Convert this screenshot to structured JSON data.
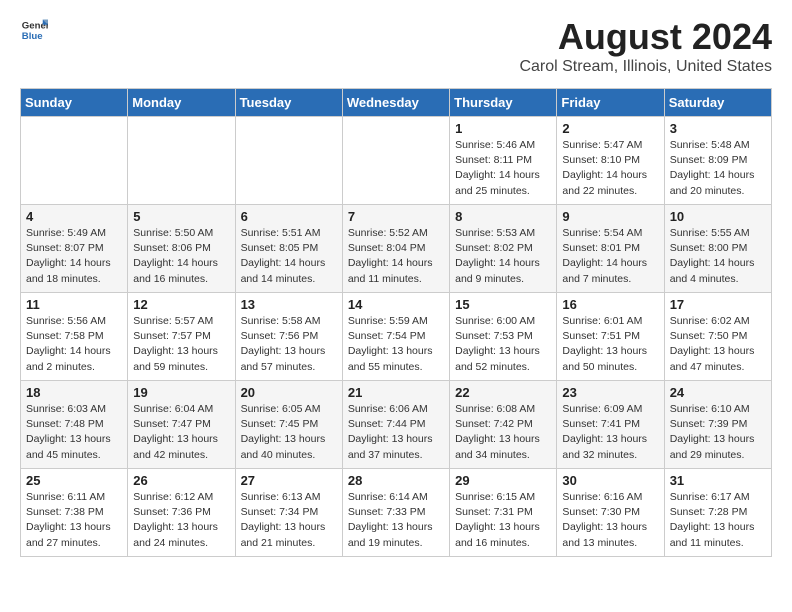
{
  "header": {
    "logo_general": "General",
    "logo_blue": "Blue",
    "month_title": "August 2024",
    "location": "Carol Stream, Illinois, United States"
  },
  "columns": [
    "Sunday",
    "Monday",
    "Tuesday",
    "Wednesday",
    "Thursday",
    "Friday",
    "Saturday"
  ],
  "weeks": [
    [
      {
        "day": "",
        "content": ""
      },
      {
        "day": "",
        "content": ""
      },
      {
        "day": "",
        "content": ""
      },
      {
        "day": "",
        "content": ""
      },
      {
        "day": "1",
        "content": "Sunrise: 5:46 AM\nSunset: 8:11 PM\nDaylight: 14 hours\nand 25 minutes."
      },
      {
        "day": "2",
        "content": "Sunrise: 5:47 AM\nSunset: 8:10 PM\nDaylight: 14 hours\nand 22 minutes."
      },
      {
        "day": "3",
        "content": "Sunrise: 5:48 AM\nSunset: 8:09 PM\nDaylight: 14 hours\nand 20 minutes."
      }
    ],
    [
      {
        "day": "4",
        "content": "Sunrise: 5:49 AM\nSunset: 8:07 PM\nDaylight: 14 hours\nand 18 minutes."
      },
      {
        "day": "5",
        "content": "Sunrise: 5:50 AM\nSunset: 8:06 PM\nDaylight: 14 hours\nand 16 minutes."
      },
      {
        "day": "6",
        "content": "Sunrise: 5:51 AM\nSunset: 8:05 PM\nDaylight: 14 hours\nand 14 minutes."
      },
      {
        "day": "7",
        "content": "Sunrise: 5:52 AM\nSunset: 8:04 PM\nDaylight: 14 hours\nand 11 minutes."
      },
      {
        "day": "8",
        "content": "Sunrise: 5:53 AM\nSunset: 8:02 PM\nDaylight: 14 hours\nand 9 minutes."
      },
      {
        "day": "9",
        "content": "Sunrise: 5:54 AM\nSunset: 8:01 PM\nDaylight: 14 hours\nand 7 minutes."
      },
      {
        "day": "10",
        "content": "Sunrise: 5:55 AM\nSunset: 8:00 PM\nDaylight: 14 hours\nand 4 minutes."
      }
    ],
    [
      {
        "day": "11",
        "content": "Sunrise: 5:56 AM\nSunset: 7:58 PM\nDaylight: 14 hours\nand 2 minutes."
      },
      {
        "day": "12",
        "content": "Sunrise: 5:57 AM\nSunset: 7:57 PM\nDaylight: 13 hours\nand 59 minutes."
      },
      {
        "day": "13",
        "content": "Sunrise: 5:58 AM\nSunset: 7:56 PM\nDaylight: 13 hours\nand 57 minutes."
      },
      {
        "day": "14",
        "content": "Sunrise: 5:59 AM\nSunset: 7:54 PM\nDaylight: 13 hours\nand 55 minutes."
      },
      {
        "day": "15",
        "content": "Sunrise: 6:00 AM\nSunset: 7:53 PM\nDaylight: 13 hours\nand 52 minutes."
      },
      {
        "day": "16",
        "content": "Sunrise: 6:01 AM\nSunset: 7:51 PM\nDaylight: 13 hours\nand 50 minutes."
      },
      {
        "day": "17",
        "content": "Sunrise: 6:02 AM\nSunset: 7:50 PM\nDaylight: 13 hours\nand 47 minutes."
      }
    ],
    [
      {
        "day": "18",
        "content": "Sunrise: 6:03 AM\nSunset: 7:48 PM\nDaylight: 13 hours\nand 45 minutes."
      },
      {
        "day": "19",
        "content": "Sunrise: 6:04 AM\nSunset: 7:47 PM\nDaylight: 13 hours\nand 42 minutes."
      },
      {
        "day": "20",
        "content": "Sunrise: 6:05 AM\nSunset: 7:45 PM\nDaylight: 13 hours\nand 40 minutes."
      },
      {
        "day": "21",
        "content": "Sunrise: 6:06 AM\nSunset: 7:44 PM\nDaylight: 13 hours\nand 37 minutes."
      },
      {
        "day": "22",
        "content": "Sunrise: 6:08 AM\nSunset: 7:42 PM\nDaylight: 13 hours\nand 34 minutes."
      },
      {
        "day": "23",
        "content": "Sunrise: 6:09 AM\nSunset: 7:41 PM\nDaylight: 13 hours\nand 32 minutes."
      },
      {
        "day": "24",
        "content": "Sunrise: 6:10 AM\nSunset: 7:39 PM\nDaylight: 13 hours\nand 29 minutes."
      }
    ],
    [
      {
        "day": "25",
        "content": "Sunrise: 6:11 AM\nSunset: 7:38 PM\nDaylight: 13 hours\nand 27 minutes."
      },
      {
        "day": "26",
        "content": "Sunrise: 6:12 AM\nSunset: 7:36 PM\nDaylight: 13 hours\nand 24 minutes."
      },
      {
        "day": "27",
        "content": "Sunrise: 6:13 AM\nSunset: 7:34 PM\nDaylight: 13 hours\nand 21 minutes."
      },
      {
        "day": "28",
        "content": "Sunrise: 6:14 AM\nSunset: 7:33 PM\nDaylight: 13 hours\nand 19 minutes."
      },
      {
        "day": "29",
        "content": "Sunrise: 6:15 AM\nSunset: 7:31 PM\nDaylight: 13 hours\nand 16 minutes."
      },
      {
        "day": "30",
        "content": "Sunrise: 6:16 AM\nSunset: 7:30 PM\nDaylight: 13 hours\nand 13 minutes."
      },
      {
        "day": "31",
        "content": "Sunrise: 6:17 AM\nSunset: 7:28 PM\nDaylight: 13 hours\nand 11 minutes."
      }
    ]
  ]
}
